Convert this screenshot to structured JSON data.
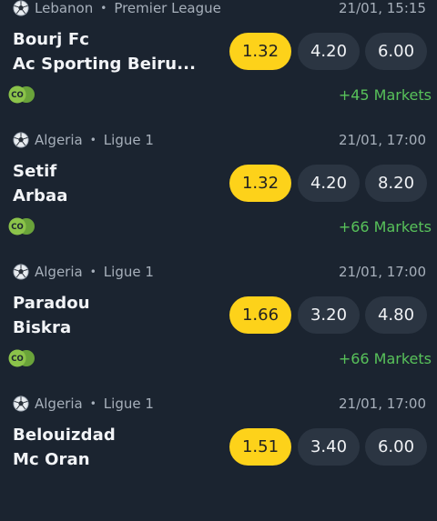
{
  "matches": [
    {
      "country": "Lebanon",
      "league": "Premier League",
      "datetime": "21/01, 15:15",
      "team1": "Bourj Fc",
      "team2": "Ac Sporting Beiru...",
      "odds": [
        "1.32",
        "4.20",
        "6.00"
      ],
      "markets": "+45 Markets"
    },
    {
      "country": "Algeria",
      "league": "Ligue 1",
      "datetime": "21/01, 17:00",
      "team1": "Setif",
      "team2": "Arbaa",
      "odds": [
        "1.32",
        "4.20",
        "8.20"
      ],
      "markets": "+66 Markets"
    },
    {
      "country": "Algeria",
      "league": "Ligue 1",
      "datetime": "21/01, 17:00",
      "team1": "Paradou",
      "team2": "Biskra",
      "odds": [
        "1.66",
        "3.20",
        "4.80"
      ],
      "markets": "+66 Markets"
    },
    {
      "country": "Algeria",
      "league": "Ligue 1",
      "datetime": "21/01, 17:00",
      "team1": "Belouizdad",
      "team2": "Mc Oran",
      "odds": [
        "1.51",
        "3.40",
        "6.00"
      ],
      "markets": ""
    }
  ],
  "separator": "•",
  "live_badge_text": "CO",
  "colors": {
    "background": "#1b2430",
    "odd_button": "#2b3542",
    "highlight": "#fdd21a",
    "markets_link": "#58c25a",
    "muted": "#a7b0bb",
    "live_badge": "#8bc34a"
  }
}
